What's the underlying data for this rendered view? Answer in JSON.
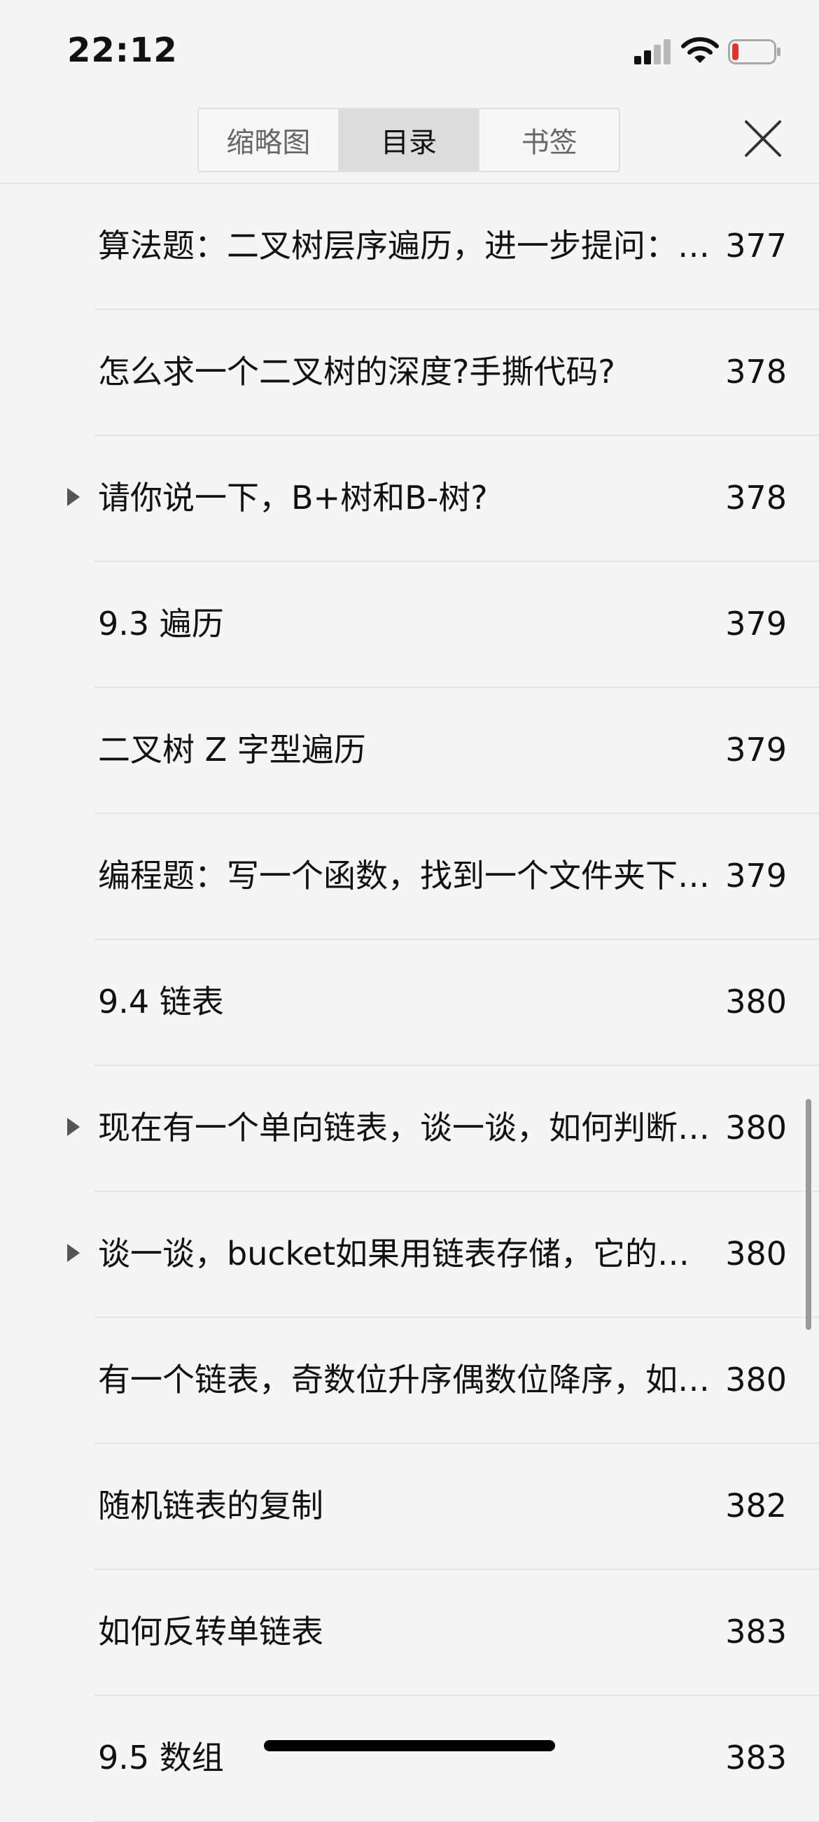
{
  "status_bar": {
    "time": "22:12",
    "signal_bars_active": 2,
    "signal_bars_total": 4,
    "battery_level": 0.15,
    "battery_color": "#e0342b"
  },
  "header": {
    "tabs": [
      {
        "label": "缩略图",
        "active": false
      },
      {
        "label": "目录",
        "active": true
      },
      {
        "label": "书签",
        "active": false
      }
    ],
    "close_icon": "close-icon"
  },
  "toc": {
    "items": [
      {
        "title": "算法题：二叉树层序遍历，进一步提问：要求每层打印出一个换行符",
        "page": "377",
        "expandable": false
      },
      {
        "title": "怎么求一个二叉树的深度?手撕代码?",
        "page": "378",
        "expandable": false
      },
      {
        "title": "请你说一下，B+树和B-树?",
        "page": "378",
        "expandable": true
      },
      {
        "title": "9.3 遍历",
        "page": "379",
        "expandable": false
      },
      {
        "title": "二叉树 Z 字型遍历",
        "page": "379",
        "expandable": false
      },
      {
        "title": "编程题：写一个函数，找到一个文件夹下所有文件",
        "page": "379",
        "expandable": false
      },
      {
        "title": "9.4 链表",
        "page": "380",
        "expandable": false
      },
      {
        "title": "现在有一个单向链表，谈一谈，如何判断链表中是否有环",
        "page": "380",
        "expandable": true
      },
      {
        "title": "谈一谈，bucket如果用链表存储，它的缺点是什么",
        "page": "380",
        "expandable": true
      },
      {
        "title": "有一个链表，奇数位升序偶数位降序，如何将链表变成升序",
        "page": "380",
        "expandable": false
      },
      {
        "title": "随机链表的复制",
        "page": "382",
        "expandable": false
      },
      {
        "title": "如何反转单链表",
        "page": "383",
        "expandable": false
      },
      {
        "title": "9.5 数组",
        "page": "383",
        "expandable": false
      }
    ]
  }
}
